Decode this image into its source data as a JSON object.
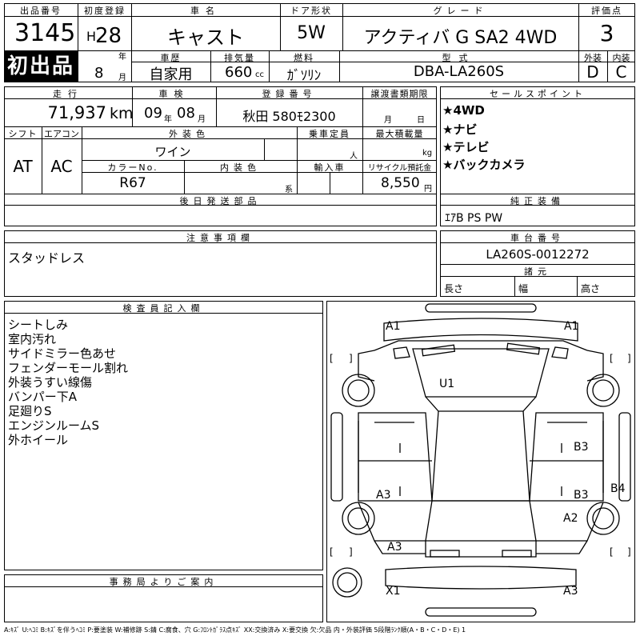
{
  "lot": {
    "label": "出品番号",
    "number": "3145",
    "badge": "初出品"
  },
  "reg": {
    "label": "初度登録",
    "era": "H",
    "year": "28",
    "year_unit": "年",
    "month": "8",
    "month_unit": "月"
  },
  "car": {
    "label": "車名",
    "name": "キャスト"
  },
  "door": {
    "label": "ドア形状",
    "value": "5W"
  },
  "grade": {
    "label": "グレード",
    "value": "アクティバ G SA2 4WD"
  },
  "score": {
    "label": "評価点",
    "value": "3",
    "ext_label": "外装",
    "int_label": "内装",
    "ext": "D",
    "int": "C"
  },
  "history": {
    "label": "車歴",
    "value": "自家用"
  },
  "disp": {
    "label": "排気量",
    "value": "660",
    "unit": "cc"
  },
  "fuel": {
    "label": "燃料",
    "value": "ｶﾞｿﾘﾝ"
  },
  "model": {
    "label": "型式",
    "value": "DBA-LA260S"
  },
  "mileage": {
    "label": "走行",
    "value": "71,937",
    "unit": "km"
  },
  "inspect": {
    "label": "車検",
    "year": "09",
    "year_unit": "年",
    "month": "08",
    "month_unit": "月"
  },
  "plate": {
    "label": "登録番号",
    "value": "秋田 580ﾓ2300"
  },
  "transfer": {
    "label": "譲渡書類期限",
    "month_unit": "月",
    "day_unit": "日"
  },
  "sales": {
    "label": "セールスポイント",
    "items": [
      "★4WD",
      "★ナビ",
      "★テレビ",
      "★バックカメラ"
    ]
  },
  "shift": {
    "label": "シフト",
    "value": "AT"
  },
  "ac": {
    "label": "エアコン",
    "value": "AC"
  },
  "ext_color": {
    "label": "外装色",
    "value": "ワイン"
  },
  "capacity": {
    "label": "乗車定員",
    "unit": "人"
  },
  "loadcap": {
    "label": "最大積載量",
    "unit": "kg"
  },
  "color_no": {
    "label": "カラーNo.",
    "value": "R67"
  },
  "int_color": {
    "label": "内装色",
    "unit": "系"
  },
  "import": {
    "label": "輸入車"
  },
  "recycle": {
    "label": "リサイクル預託金",
    "value": "8,550",
    "unit": "円"
  },
  "later": {
    "label": "後日発送部品"
  },
  "equip": {
    "label": "純正装備",
    "value": "ｴｱB PS PW"
  },
  "notes": {
    "label": "注意事項欄",
    "value": "スタッドレス"
  },
  "chassis": {
    "label": "車台番号",
    "value": "LA260S-0012272"
  },
  "specs": {
    "label": "諸元",
    "length": "長さ",
    "width": "幅",
    "height": "高さ"
  },
  "inspector": {
    "label": "検査員記入欄",
    "items": [
      "シートしみ",
      "室内汚れ",
      "サイドミラー色あせ",
      "フェンダーモール割れ",
      "外装うすい線傷",
      "バンパー下A",
      "足廻りS",
      "エンジンルームS",
      "外ホイール"
    ]
  },
  "office": {
    "label": "事務局よりご案内"
  },
  "diagram": {
    "marks": {
      "a1l": "A1",
      "a1r": "A1",
      "u1": "U1",
      "b3a": "B3",
      "b3b": "B3",
      "a3a": "A3",
      "a3b": "A3",
      "b4": "B4",
      "a2": "A2",
      "x1": "X1",
      "a3c": "A3"
    }
  },
  "legend": "A:ｷｽﾞ U:ﾍｺﾐ B:ｷｽﾞを伴うﾍｺﾐ P:要塗装 W:補修跡 S:錆 C:腐食、穴 G:ﾌﾛﾝﾄｶﾞﾗｽ点ｷｽﾞ XX:交換済み X:要交換 欠:欠品 内・外装評価 5段階ﾗﾝｸ順(A・B・C・D・E) 1"
}
